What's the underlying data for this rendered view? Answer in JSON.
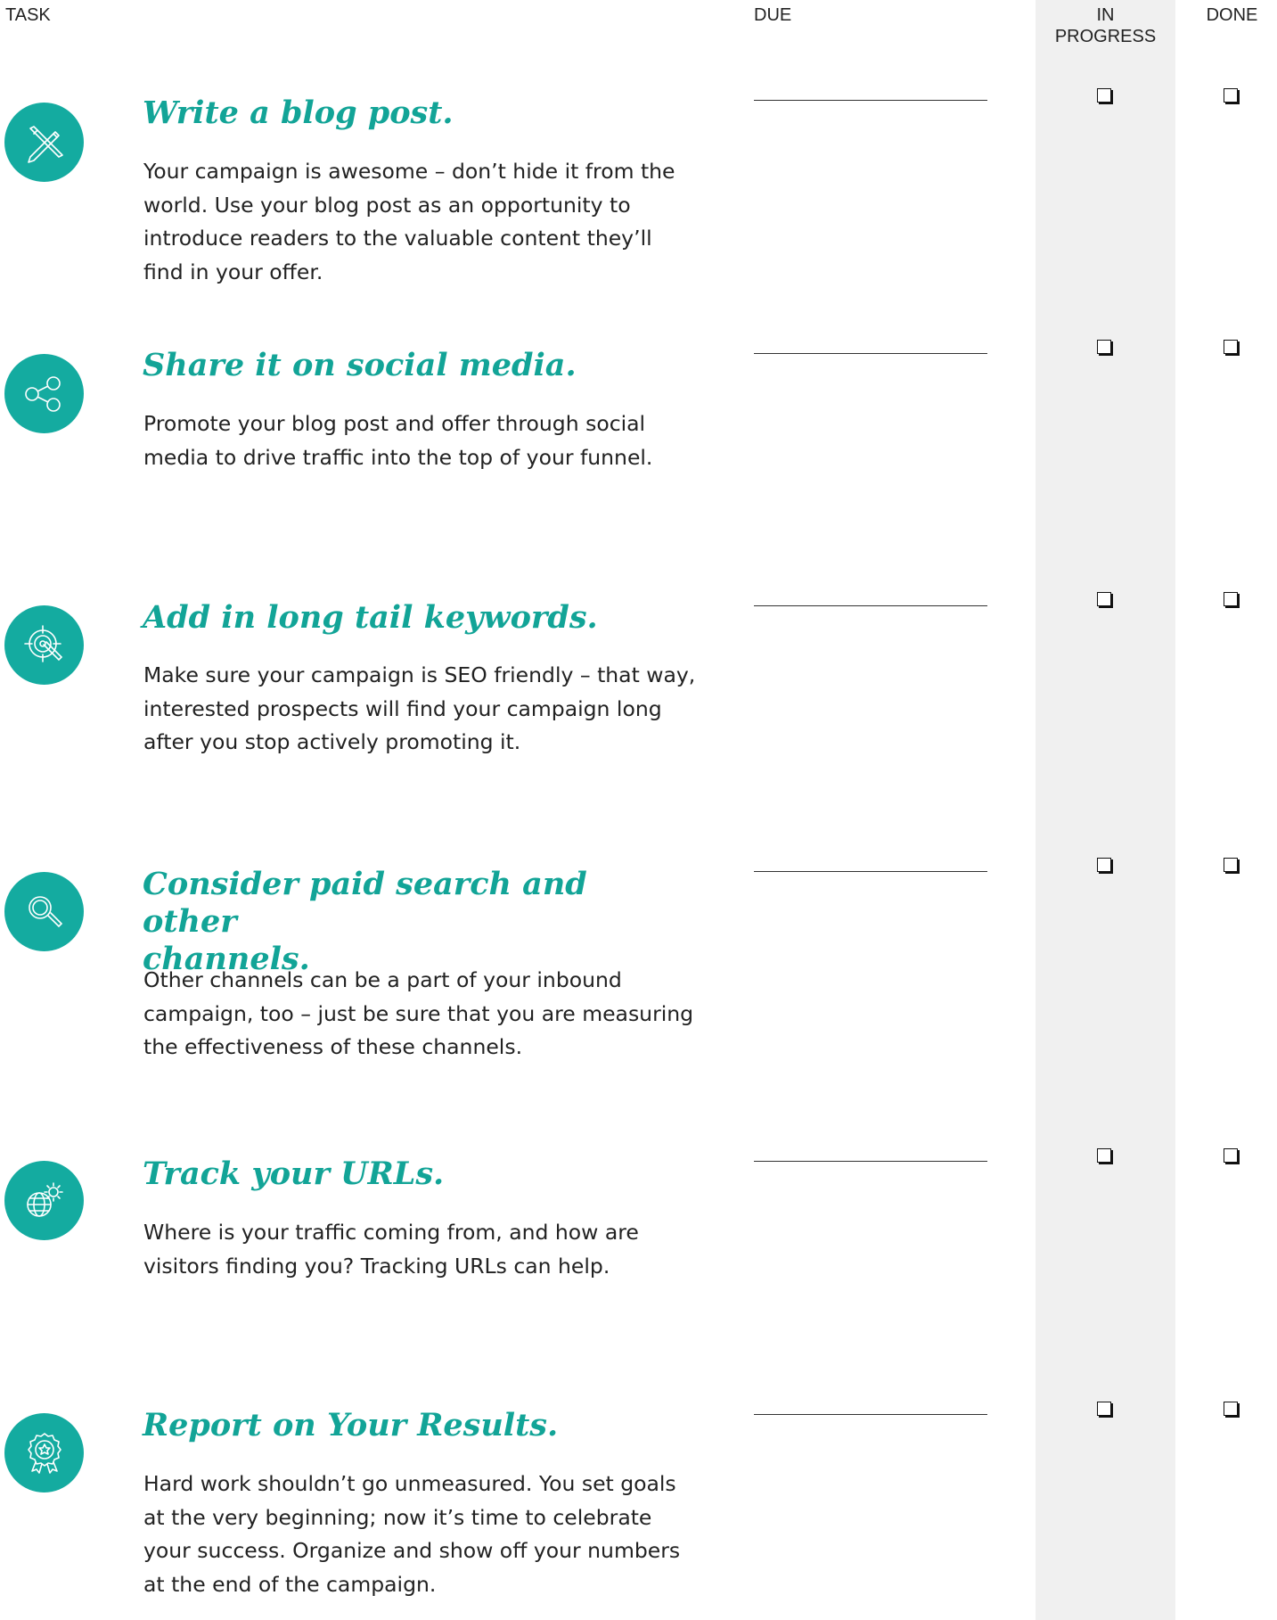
{
  "header": {
    "task": "TASK",
    "due": "DUE",
    "in_progress_line1": "IN",
    "in_progress_line2": "PROGRESS",
    "done": "DONE"
  },
  "colors": {
    "accent": "#14aba0",
    "title": "#12a497",
    "in_progress_band": "#f0f0f0"
  },
  "tasks": [
    {
      "icon": "pencil-ruler-icon",
      "title": "Write a blog post.",
      "lines": [
        "Your campaign is awesome – don’t hide it from the",
        "world. Use your blog post as an opportunity to",
        "introduce readers to the valuable content they’ll",
        "find in your offer."
      ],
      "in_progress": false,
      "done": false
    },
    {
      "icon": "share-icon",
      "title": "Share it on social media.",
      "lines": [
        "Promote your blog post and offer through social",
        "media to drive traffic into the top of your funnel."
      ],
      "in_progress": false,
      "done": false
    },
    {
      "icon": "target-icon",
      "title": "Add in long tail keywords.",
      "lines": [
        "Make sure your campaign is SEO friendly – that way,",
        "interested prospects will find your campaign long",
        "after you stop actively promoting it."
      ],
      "in_progress": false,
      "done": false
    },
    {
      "icon": "magnifier-icon",
      "title_line1": "Consider paid search and other",
      "title_line2": "channels.",
      "lines": [
        "Other channels can be a part of your inbound",
        "campaign, too – just be sure that you are measuring",
        "the effectiveness of these channels."
      ],
      "in_progress": false,
      "done": false
    },
    {
      "icon": "globe-gear-icon",
      "title": "Track your URLs.",
      "lines": [
        "Where is your traffic coming from, and how are",
        "visitors finding you? Tracking URLs can help."
      ],
      "in_progress": false,
      "done": false
    },
    {
      "icon": "award-badge-icon",
      "title": "Report on Your Results.",
      "lines": [
        "Hard work shouldn’t go unmeasured. You set goals",
        "at the very beginning; now it’s time to celebrate",
        "your success. Organize and show off your numbers",
        "at the end of the campaign."
      ],
      "in_progress": false,
      "done": false
    }
  ]
}
